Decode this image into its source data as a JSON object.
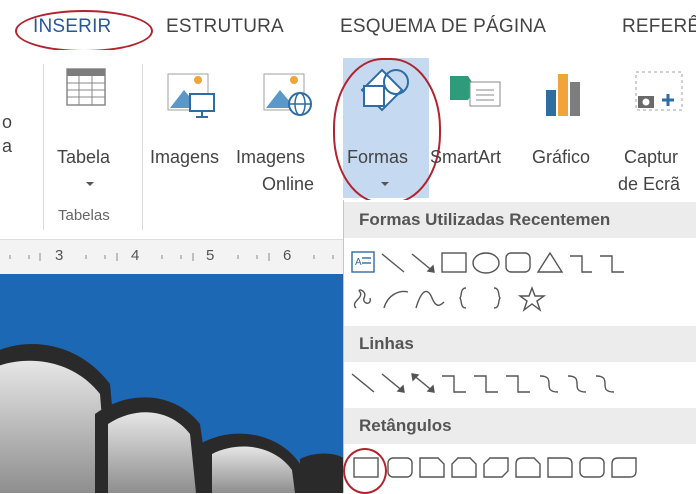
{
  "tabs": [
    {
      "label": "INSERIR",
      "active": true
    },
    {
      "label": "ESTRUTURA",
      "active": false
    },
    {
      "label": "ESQUEMA DE PÁGINA",
      "active": false
    },
    {
      "label": "REFERÊ",
      "active": false
    }
  ],
  "ribbon": {
    "cut_left_line1": "o",
    "cut_left_line2": "a",
    "tabela_label": "Tabela",
    "tabelas_group_label": "Tabelas",
    "imagens_label": "Imagens",
    "imagens_online_line1": "Imagens",
    "imagens_online_line2": "Online",
    "formas_label": "Formas",
    "smartart_label": "SmartArt",
    "grafico_label": "Gráfico",
    "captura_line1": "Captur",
    "captura_line2": "de Ecrã"
  },
  "ruler": {
    "numbers": [
      "3",
      "4",
      "5",
      "6"
    ]
  },
  "shapes_panel": {
    "recent_header": "Formas Utilizadas Recentemen",
    "lines_header": "Linhas",
    "rect_header": "Retângulos"
  },
  "colors": {
    "accent": "#2b579a",
    "highlight_red": "#b2232d",
    "selected_bg": "#c5d9f1",
    "doc_blue": "#1d68b4"
  }
}
